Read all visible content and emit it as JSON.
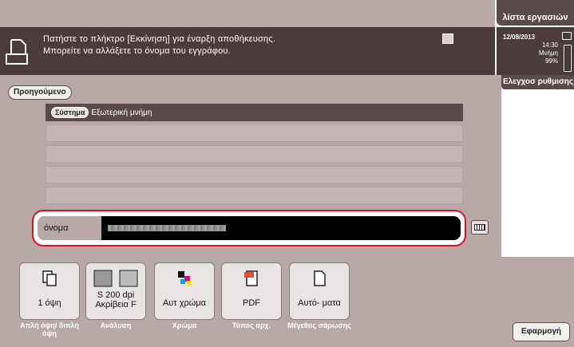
{
  "header": {
    "job_list": "λίστα εργασιών",
    "message_line1": "Πατήστε το πλήκτρο [Εκκίνηση] για έναρξη αποθήκευσης.",
    "message_line2": "Μπορείτε να αλλάξετε το όνομα του εγγράφου."
  },
  "status": {
    "date": "12/08/2013",
    "time": "14:30",
    "memory_label": "Μνήμη",
    "memory_value": "99%"
  },
  "settings_tab": "Ελεγχοσ ρυθμισης",
  "back_button": "Προηγούμενο",
  "destination": {
    "system_badge": "Σύστημα",
    "path": "Εξωτερική μνήμη"
  },
  "name_field": {
    "label": "όνομα"
  },
  "functions": [
    {
      "value": "1 όψη",
      "caption": "Απλή όψη/ διπλή όψη",
      "icon": "simplex-duplex-icon"
    },
    {
      "value_line1": "S 200 dpi",
      "value_line2": "Ακρίβεια F",
      "caption": "Ανάλυση",
      "icon": "resolution-icon"
    },
    {
      "value": "Αυτ χρώμα",
      "caption": "Χρώμα",
      "icon": "color-icon"
    },
    {
      "value": "PDF",
      "caption": "Τύπος αρχ.",
      "icon": "pdf-file-icon"
    },
    {
      "value": "Αυτό- ματα",
      "caption": "Μέγεθος σάρωσης",
      "icon": "scan-size-icon"
    }
  ],
  "apply_button": "Εφαρμογή",
  "colors": {
    "accent_outline": "#d9112a",
    "dark_panel": "#4b3b3b",
    "background": "#b8a8a6"
  }
}
